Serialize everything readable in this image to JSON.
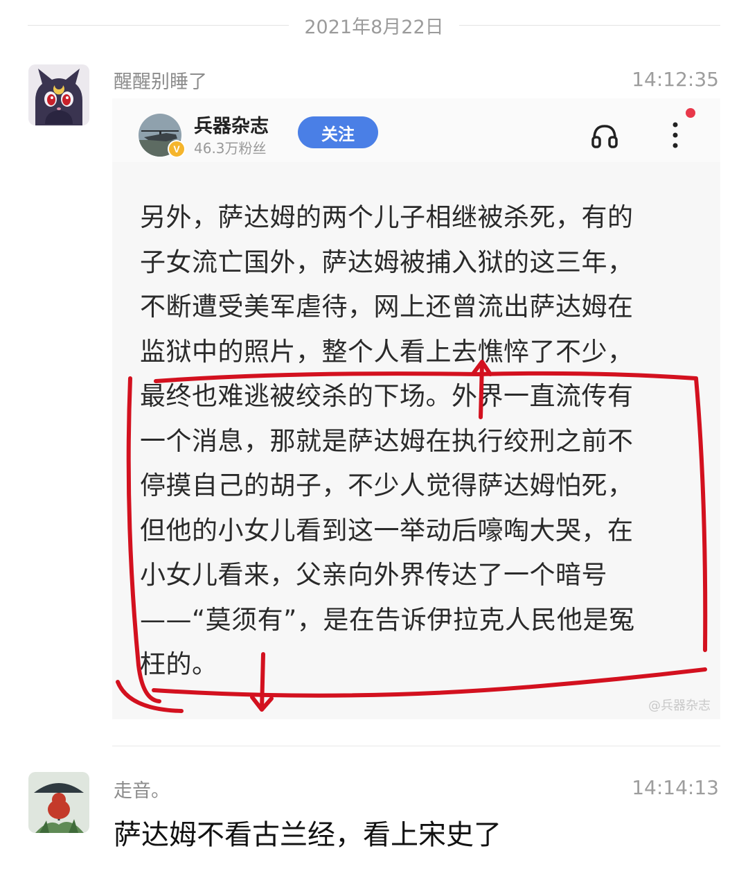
{
  "date_divider": "2021年8月22日",
  "messages": [
    {
      "sender": "醒醒别睡了",
      "time": "14:12:35",
      "avatar_icon": "black-cat-crescent-moon-avatar",
      "image_card": {
        "account_name": "兵器杂志",
        "fans": "46.3万粉丝",
        "follow_label": "关注",
        "verified_badge": "V",
        "icons": [
          "headphone-icon",
          "more-vertical-icon"
        ],
        "article_lines": [
          "另外，萨达姆的两个儿子相继被杀死，有的",
          "子女流亡国外，萨达姆被捕入狱的这三年，",
          "不断遭受美军虐待，网上还曾流出萨达姆在",
          "监狱中的照片，整个人看上去憔悴了不少，",
          "最终也难逃被绞杀的下场。外界一直流传有",
          "一个消息，那就是萨达姆在执行绞刑之前不",
          "停摸自己的胡子，不少人觉得萨达姆怕死，",
          "但他的小女儿看到这一举动后嚎啕大哭，在",
          "小女儿看来，父亲向外界传达了一个暗号",
          "——“莫须有”，是在告诉伊拉克人民他是冤",
          "枉的。"
        ],
        "watermark": "@兵器杂志",
        "annotation_color": "#d3111f"
      }
    },
    {
      "sender": "走音。",
      "time": "14:14:13",
      "avatar_icon": "red-figure-umbrella-avatar",
      "text": "萨达姆不看古兰经，看上宋史了"
    }
  ]
}
